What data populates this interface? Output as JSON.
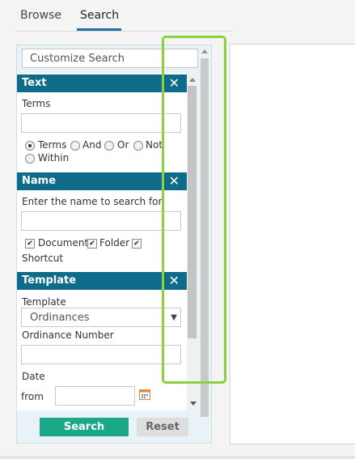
{
  "tabs": [
    {
      "label": "Browse",
      "active": false
    },
    {
      "label": "Search",
      "active": true
    }
  ],
  "customize": {
    "label": "Customize Search"
  },
  "sections": {
    "text": {
      "title": "Text",
      "terms_label": "Terms",
      "options": [
        "Terms",
        "And",
        "Or",
        "Not",
        "Within"
      ],
      "selected": "Terms"
    },
    "name": {
      "title": "Name",
      "prompt": "Enter the name to search for",
      "checks": [
        {
          "label": "Document",
          "checked": true
        },
        {
          "label": "Folder",
          "checked": true
        },
        {
          "label": "Shortcut",
          "checked": true
        }
      ]
    },
    "template": {
      "title": "Template",
      "template_label": "Template",
      "template_value": "Ordinances",
      "ord_label": "Ordinance Number",
      "date_label": "Date",
      "from_label": "from"
    }
  },
  "buttons": {
    "search": "Search",
    "reset": "Reset"
  },
  "colors": {
    "header": "#0f6b8a",
    "search_button": "#1aa888",
    "highlight": "#8ad13c",
    "tab_underline": "#1f6f9f"
  },
  "icons": {
    "close": "close-icon",
    "calendar": "calendar-icon",
    "dropdown": "chevron-down-icon"
  }
}
